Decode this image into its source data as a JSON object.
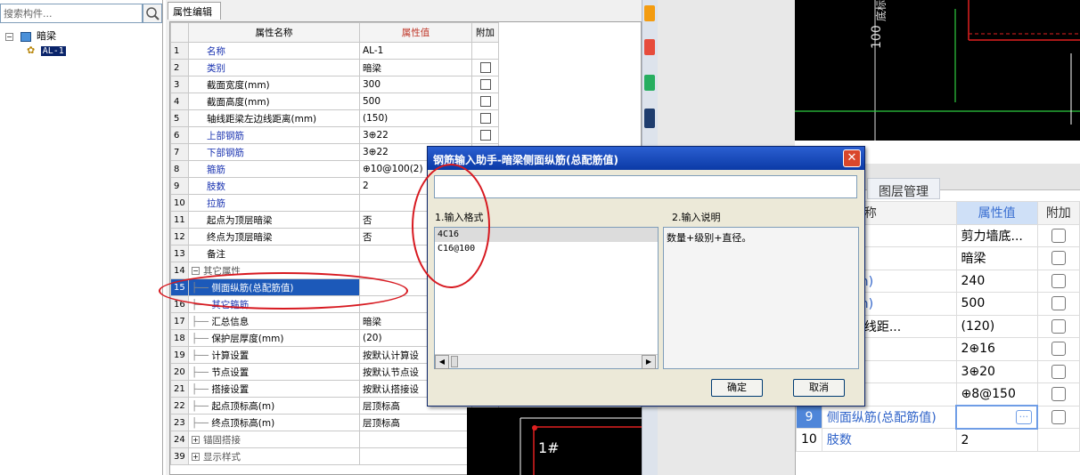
{
  "left_tree": {
    "search_placeholder": "搜索构件...",
    "root_label": "暗梁",
    "child_label": "AL-1"
  },
  "prop_panel": {
    "tab": "属性编辑",
    "headers": {
      "name": "属性名称",
      "value": "属性值",
      "extra": "附加"
    },
    "rows": [
      {
        "num": "1",
        "name": "名称",
        "value": "AL-1",
        "blue": true,
        "check": false
      },
      {
        "num": "2",
        "name": "类别",
        "value": "暗梁",
        "blue": true,
        "check": true
      },
      {
        "num": "3",
        "name": "截面宽度(mm)",
        "value": "300",
        "blue": false,
        "check": true
      },
      {
        "num": "4",
        "name": "截面高度(mm)",
        "value": "500",
        "blue": false,
        "check": true
      },
      {
        "num": "5",
        "name": "轴线距梁左边线距离(mm)",
        "value": "(150)",
        "blue": false,
        "check": true
      },
      {
        "num": "6",
        "name": "上部钢筋",
        "value": "3⊕22",
        "blue": true,
        "check": true
      },
      {
        "num": "7",
        "name": "下部钢筋",
        "value": "3⊕22",
        "blue": true,
        "check": false
      },
      {
        "num": "8",
        "name": "箍筋",
        "value": "⊕10@100(2)",
        "blue": true,
        "check": false
      },
      {
        "num": "9",
        "name": "肢数",
        "value": "2",
        "blue": true,
        "check": false
      },
      {
        "num": "10",
        "name": "拉筋",
        "value": "",
        "blue": true,
        "check": false
      },
      {
        "num": "11",
        "name": "起点为顶层暗梁",
        "value": "否",
        "blue": false,
        "check": false
      },
      {
        "num": "12",
        "name": "终点为顶层暗梁",
        "value": "否",
        "blue": false,
        "check": false
      },
      {
        "num": "13",
        "name": "备注",
        "value": "",
        "blue": false,
        "check": false
      },
      {
        "num": "14",
        "name": "其它属性",
        "value": "",
        "blue": false,
        "check": false
      },
      {
        "num": "15",
        "name": "侧面纵筋(总配筋值)",
        "value": "",
        "blue": false,
        "check": false
      },
      {
        "num": "16",
        "name": "其它箍筋",
        "value": "",
        "blue": true,
        "check": false
      },
      {
        "num": "17",
        "name": "汇总信息",
        "value": "暗梁",
        "blue": false,
        "check": false
      },
      {
        "num": "18",
        "name": "保护层厚度(mm)",
        "value": "(20)",
        "blue": false,
        "check": false
      },
      {
        "num": "19",
        "name": "计算设置",
        "value": "按默认计算设",
        "blue": false,
        "check": false
      },
      {
        "num": "20",
        "name": "节点设置",
        "value": "按默认节点设",
        "blue": false,
        "check": false
      },
      {
        "num": "21",
        "name": "搭接设置",
        "value": "按默认搭接设",
        "blue": false,
        "check": false
      },
      {
        "num": "22",
        "name": "起点顶标高(m)",
        "value": "层顶标高",
        "blue": false,
        "check": false
      },
      {
        "num": "23",
        "name": "终点顶标高(m)",
        "value": "层顶标高",
        "blue": false,
        "check": false
      },
      {
        "num": "24",
        "name": "锚固搭接",
        "value": "",
        "blue": false,
        "check": false
      },
      {
        "num": "39",
        "name": "显示样式",
        "value": "",
        "blue": false,
        "check": false
      }
    ]
  },
  "dialog": {
    "title": "钢筋输入助手-暗梁侧面纵筋(总配筋值)",
    "close": "✕",
    "input_value": "",
    "format_label": "1.输入格式",
    "desc_label": "2.输入说明",
    "formats": [
      "4C16",
      "C16@100"
    ],
    "description": "数量+级别+直径。",
    "ok": "确定",
    "cancel": "取消"
  },
  "right_panel": {
    "tab": "图层管理",
    "headers": {
      "name": "属性名称",
      "value": "属性值",
      "extra": "附加"
    },
    "rows": [
      {
        "num": "",
        "name": "",
        "value": "剪力墙底...",
        "blue": false
      },
      {
        "num": "",
        "name": "",
        "value": "暗梁",
        "blue": false
      },
      {
        "num": "",
        "name": "度(mm)",
        "value": "240",
        "blue": true
      },
      {
        "num": "",
        "name": "度(mm)",
        "value": "500",
        "blue": true
      },
      {
        "num": "",
        "name": "梁左边线距...",
        "value": "(120)",
        "blue": false
      },
      {
        "num": "",
        "name": "筋",
        "value": "2⊕16",
        "blue": true
      },
      {
        "num": "",
        "name": "筋",
        "value": "3⊕20",
        "blue": true
      },
      {
        "num": "",
        "name": "",
        "value": "⊕8@150",
        "blue": false
      },
      {
        "num": "9",
        "name": "侧面纵筋(总配筋值)",
        "value": "",
        "blue": true
      },
      {
        "num": "10",
        "name": "肢数",
        "value": "2",
        "blue": true
      }
    ],
    "edit_button": "···"
  },
  "cad": {
    "top_text_1": "100",
    "top_text_2": "底标",
    "bottom_text": "1#"
  },
  "colors": {
    "annotation": "#d71920",
    "title_bar": "#0b3aa6",
    "selected_row": "#1c59b9"
  }
}
